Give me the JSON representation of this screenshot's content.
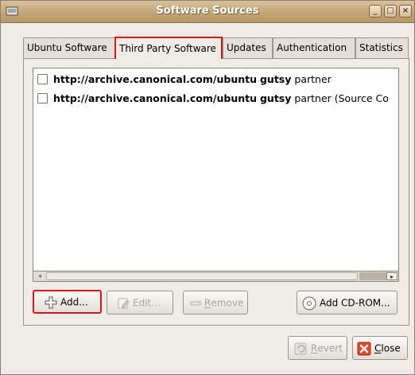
{
  "window": {
    "title": "Software Sources"
  },
  "tabs": [
    {
      "label": "Ubuntu Software"
    },
    {
      "label": "Third Party Software"
    },
    {
      "label": "Updates"
    },
    {
      "label": "Authentication"
    },
    {
      "label": "Statistics"
    }
  ],
  "sources": [
    {
      "url": "http://archive.canonical.com/ubuntu",
      "dist": "gutsy",
      "rest": "partner",
      "checked": false
    },
    {
      "url": "http://archive.canonical.com/ubuntu",
      "dist": "gutsy",
      "rest": "partner (Source Co",
      "checked": false
    }
  ],
  "buttons": {
    "add": "Add...",
    "edit": "Edit...",
    "remove_prefix": "",
    "remove_mnemonic": "R",
    "remove_suffix": "emove",
    "add_cdrom": "Add CD-ROM...",
    "revert_mnemonic": "R",
    "revert_suffix": "evert",
    "close_mnemonic": "C",
    "close_suffix": "lose"
  },
  "colors": {
    "highlight": "#d9141a",
    "titlebar": "#c4a877"
  }
}
